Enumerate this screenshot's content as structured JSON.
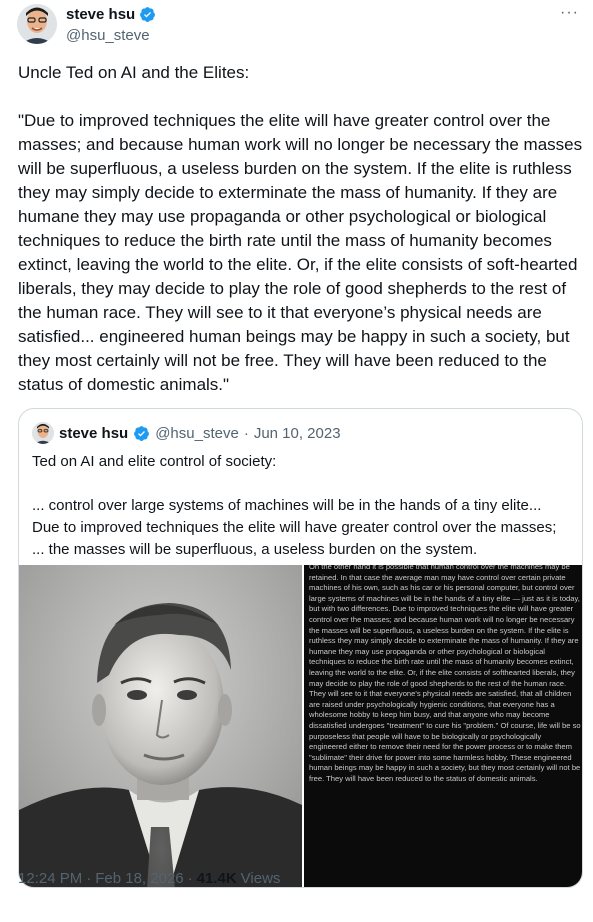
{
  "author": {
    "name": "steve hsu",
    "handle": "@hsu_steve",
    "avatar_icon": "person-avatar-icon",
    "verified_color": "#1d9bf0"
  },
  "more_label": "···",
  "tweet_text": "Uncle Ted on AI and the Elites:\n\n\"Due to improved techniques the elite will have greater control over the masses; and because human work will no longer be necessary the masses will be superfluous, a useless burden on the system. If the elite is ruthless they may simply decide to exterminate the mass of humanity. If they are humane they may use propaganda or other psychological or biological techniques to reduce the birth rate until the mass of humanity becomes extinct, leaving the world to the elite. Or, if the elite consists of soft-hearted liberals, they may decide to play the role of good shepherds to the rest of the human race. They will see to it that everyone’s physical needs are satisfied... engineered human beings may be happy in such a society, but they most certainly will not be free. They will have been reduced to the status of domestic animals.\"",
  "quote": {
    "name": "steve hsu",
    "handle": "@hsu_steve",
    "separator": "·",
    "date": "Jun 10, 2023",
    "text": "Ted on AI and elite control of society:\n\n... control over large systems of machines will be in the hands of a tiny elite...\nDue to improved techniques the elite will have greater control over the masses;\n... the masses will be superfluous, a useless burden on the system.",
    "image_text": "On the other hand it is possible that human control over the machines may be retained. In that case the average man may have control over certain private machines of his own, such as his car or his personal computer, but control over large systems of machines will be in the hands of a tiny elite — just as it is today, but with two differences. Due to improved techniques the elite will have greater control over the masses; and because human work will no longer be necessary the masses will be superfluous, a useless burden on the system. If the elite is ruthless they may simply decide to exterminate the mass of humanity. If they are humane they may use propaganda or other psychological or biological techniques to reduce the birth rate until the mass of humanity becomes extinct, leaving the world to the elite. Or, if the elite consists of softhearted liberals, they may decide to play the role of good shepherds to the rest of the human race. They will see to it that everyone's physical needs are satisfied, that all children are raised under psychologically hygienic conditions, that everyone has a wholesome hobby to keep him busy, and that anyone who may become dissatisfied undergoes \"treatment\" to cure his \"problem.\" Of course, life will be so purposeless that people will have to be biologically or psychologically engineered either to remove their need for the power process or to make them \"sublimate\" their drive for power into some harmless hobby. These engineered human beings may be happy in such a society, but they most certainly will not be free. They will have been reduced to the status of domestic animals."
  },
  "footer": {
    "time": "12:24 PM",
    "sep1": "·",
    "date": "Feb 18, 2026",
    "sep2": "·",
    "views_count": "41.4K",
    "views_label": "Views"
  }
}
